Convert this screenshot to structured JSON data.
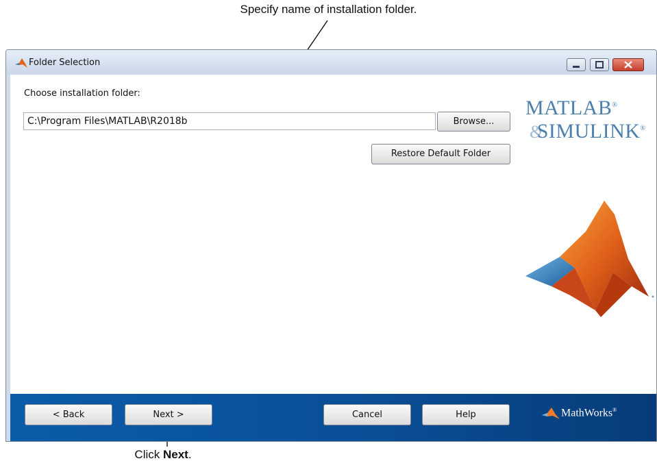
{
  "annotations": {
    "top": "Specify name of installation folder.",
    "bottom_prefix": "Click ",
    "bottom_bold": "Next",
    "bottom_suffix": "."
  },
  "window": {
    "title": "Folder Selection",
    "icon": "matlab-membrane-icon"
  },
  "form": {
    "folder_label": "Choose installation folder:",
    "folder_value": "C:\\Program Files\\MATLAB\\R2018b",
    "browse_label": "Browse...",
    "restore_label": "Restore Default Folder"
  },
  "logo": {
    "line1": "MATLAB",
    "line2_amp": "&",
    "line2": "SIMULINK",
    "registered": "®"
  },
  "footer": {
    "back_label": "< Back",
    "next_label": "Next >",
    "cancel_label": "Cancel",
    "help_label": "Help",
    "brand": "MathWorks",
    "brand_registered": "®"
  },
  "colors": {
    "footer_blue": "#0b5ca9",
    "logo_blue": "#4a7fae",
    "close_red": "#c4402b"
  }
}
